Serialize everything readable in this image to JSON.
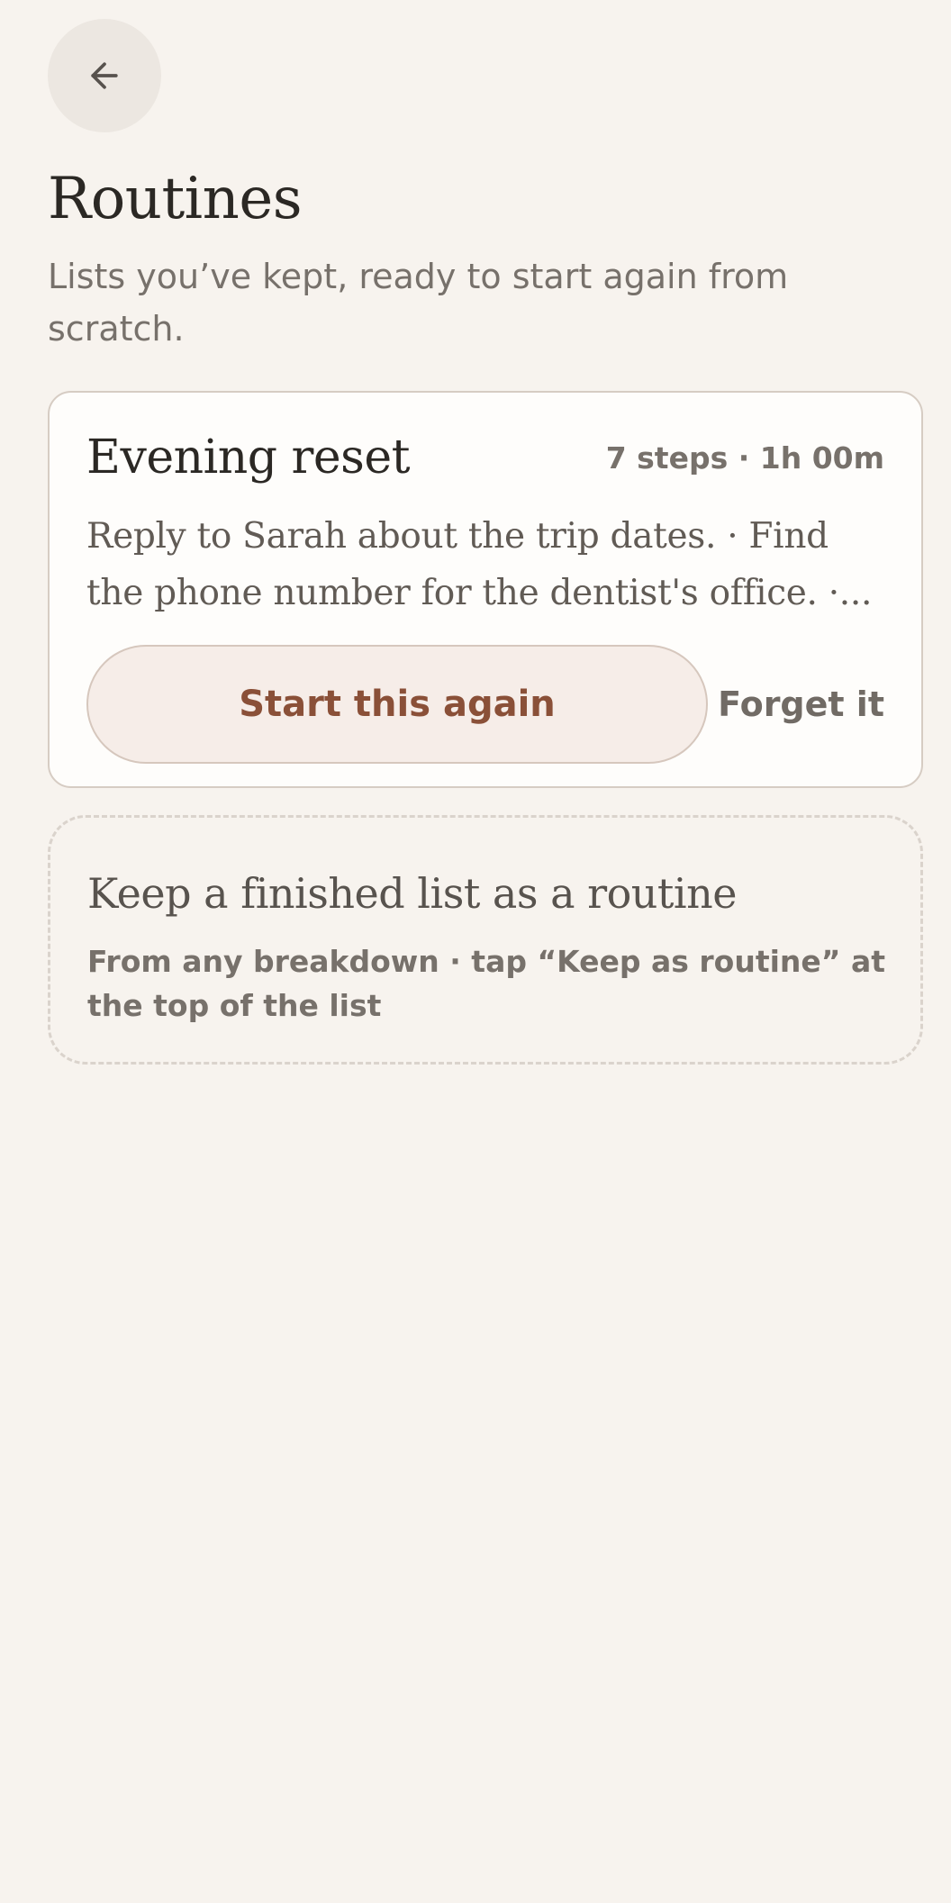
{
  "header": {
    "back_icon": "arrow-left-icon",
    "title": "Routines",
    "subtitle": "Lists you’ve kept, ready to start again from scratch."
  },
  "routines": [
    {
      "name": "Evening reset",
      "meta": "7 steps · 1h 00m",
      "preview": "Reply to Sarah about the trip dates. · Find the phone number for the dentist's office. ·...",
      "start_label": "Start this again",
      "forget_label": "Forget it"
    }
  ],
  "hint": {
    "title": "Keep a finished list as a routine",
    "description": "From any breakdown · tap “Keep as routine” at the top of the list"
  },
  "colors": {
    "background": "#f7f3ee",
    "card": "#fefdfb",
    "accent_text": "#8a5038",
    "accent_fill": "#f6ede8"
  }
}
